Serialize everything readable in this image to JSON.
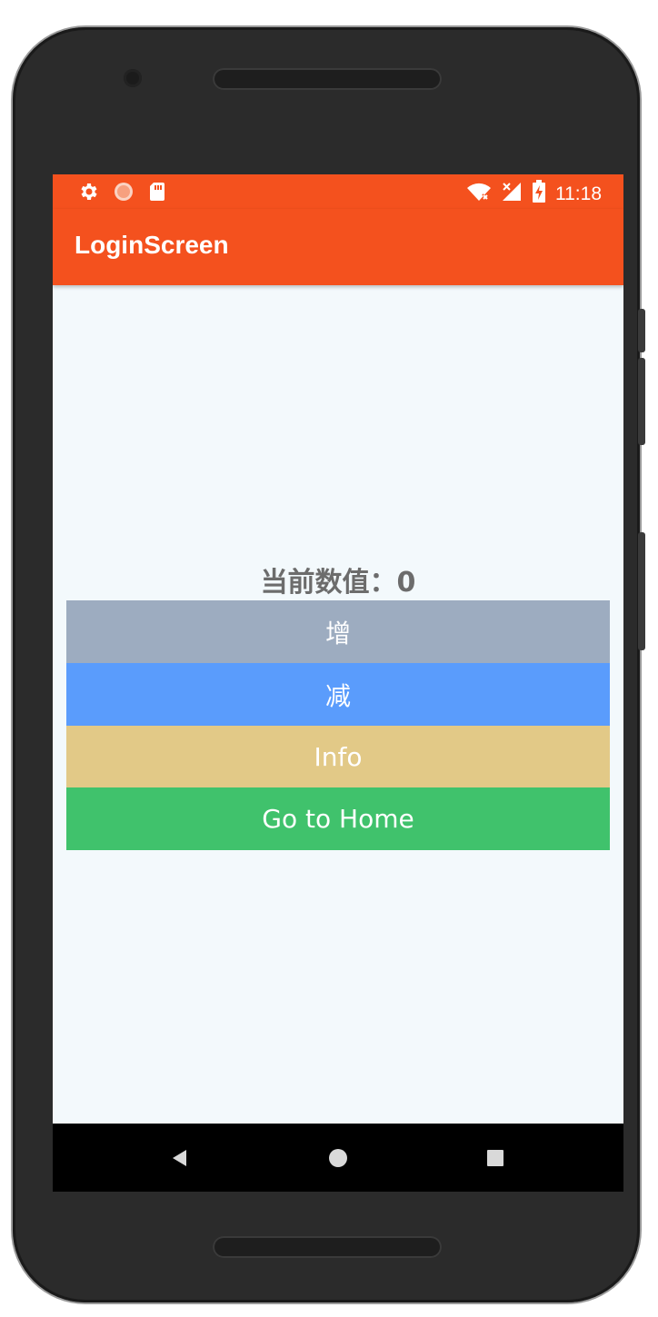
{
  "status_bar": {
    "time": "11:18",
    "left_icons": [
      "gear-icon",
      "record-icon",
      "sd-card-icon"
    ],
    "right_icons": [
      "wifi-icon",
      "signal-icon",
      "battery-icon"
    ]
  },
  "app_bar": {
    "title": "LoginScreen"
  },
  "main": {
    "counter_text": "当前数值：0",
    "buttons": [
      {
        "label": "增",
        "color": "#9dacc0"
      },
      {
        "label": "减",
        "color": "#5a9cfc"
      },
      {
        "label": "Info",
        "color": "#e2c987"
      },
      {
        "label": "Go to Home",
        "color": "#40c26c"
      }
    ]
  },
  "nav_bar": {
    "icons": [
      "back-icon",
      "home-icon",
      "recents-icon"
    ]
  },
  "theme": {
    "primary": "#f4511e",
    "background": "#f3f9fc",
    "counter_color": "#6c6c6c"
  }
}
